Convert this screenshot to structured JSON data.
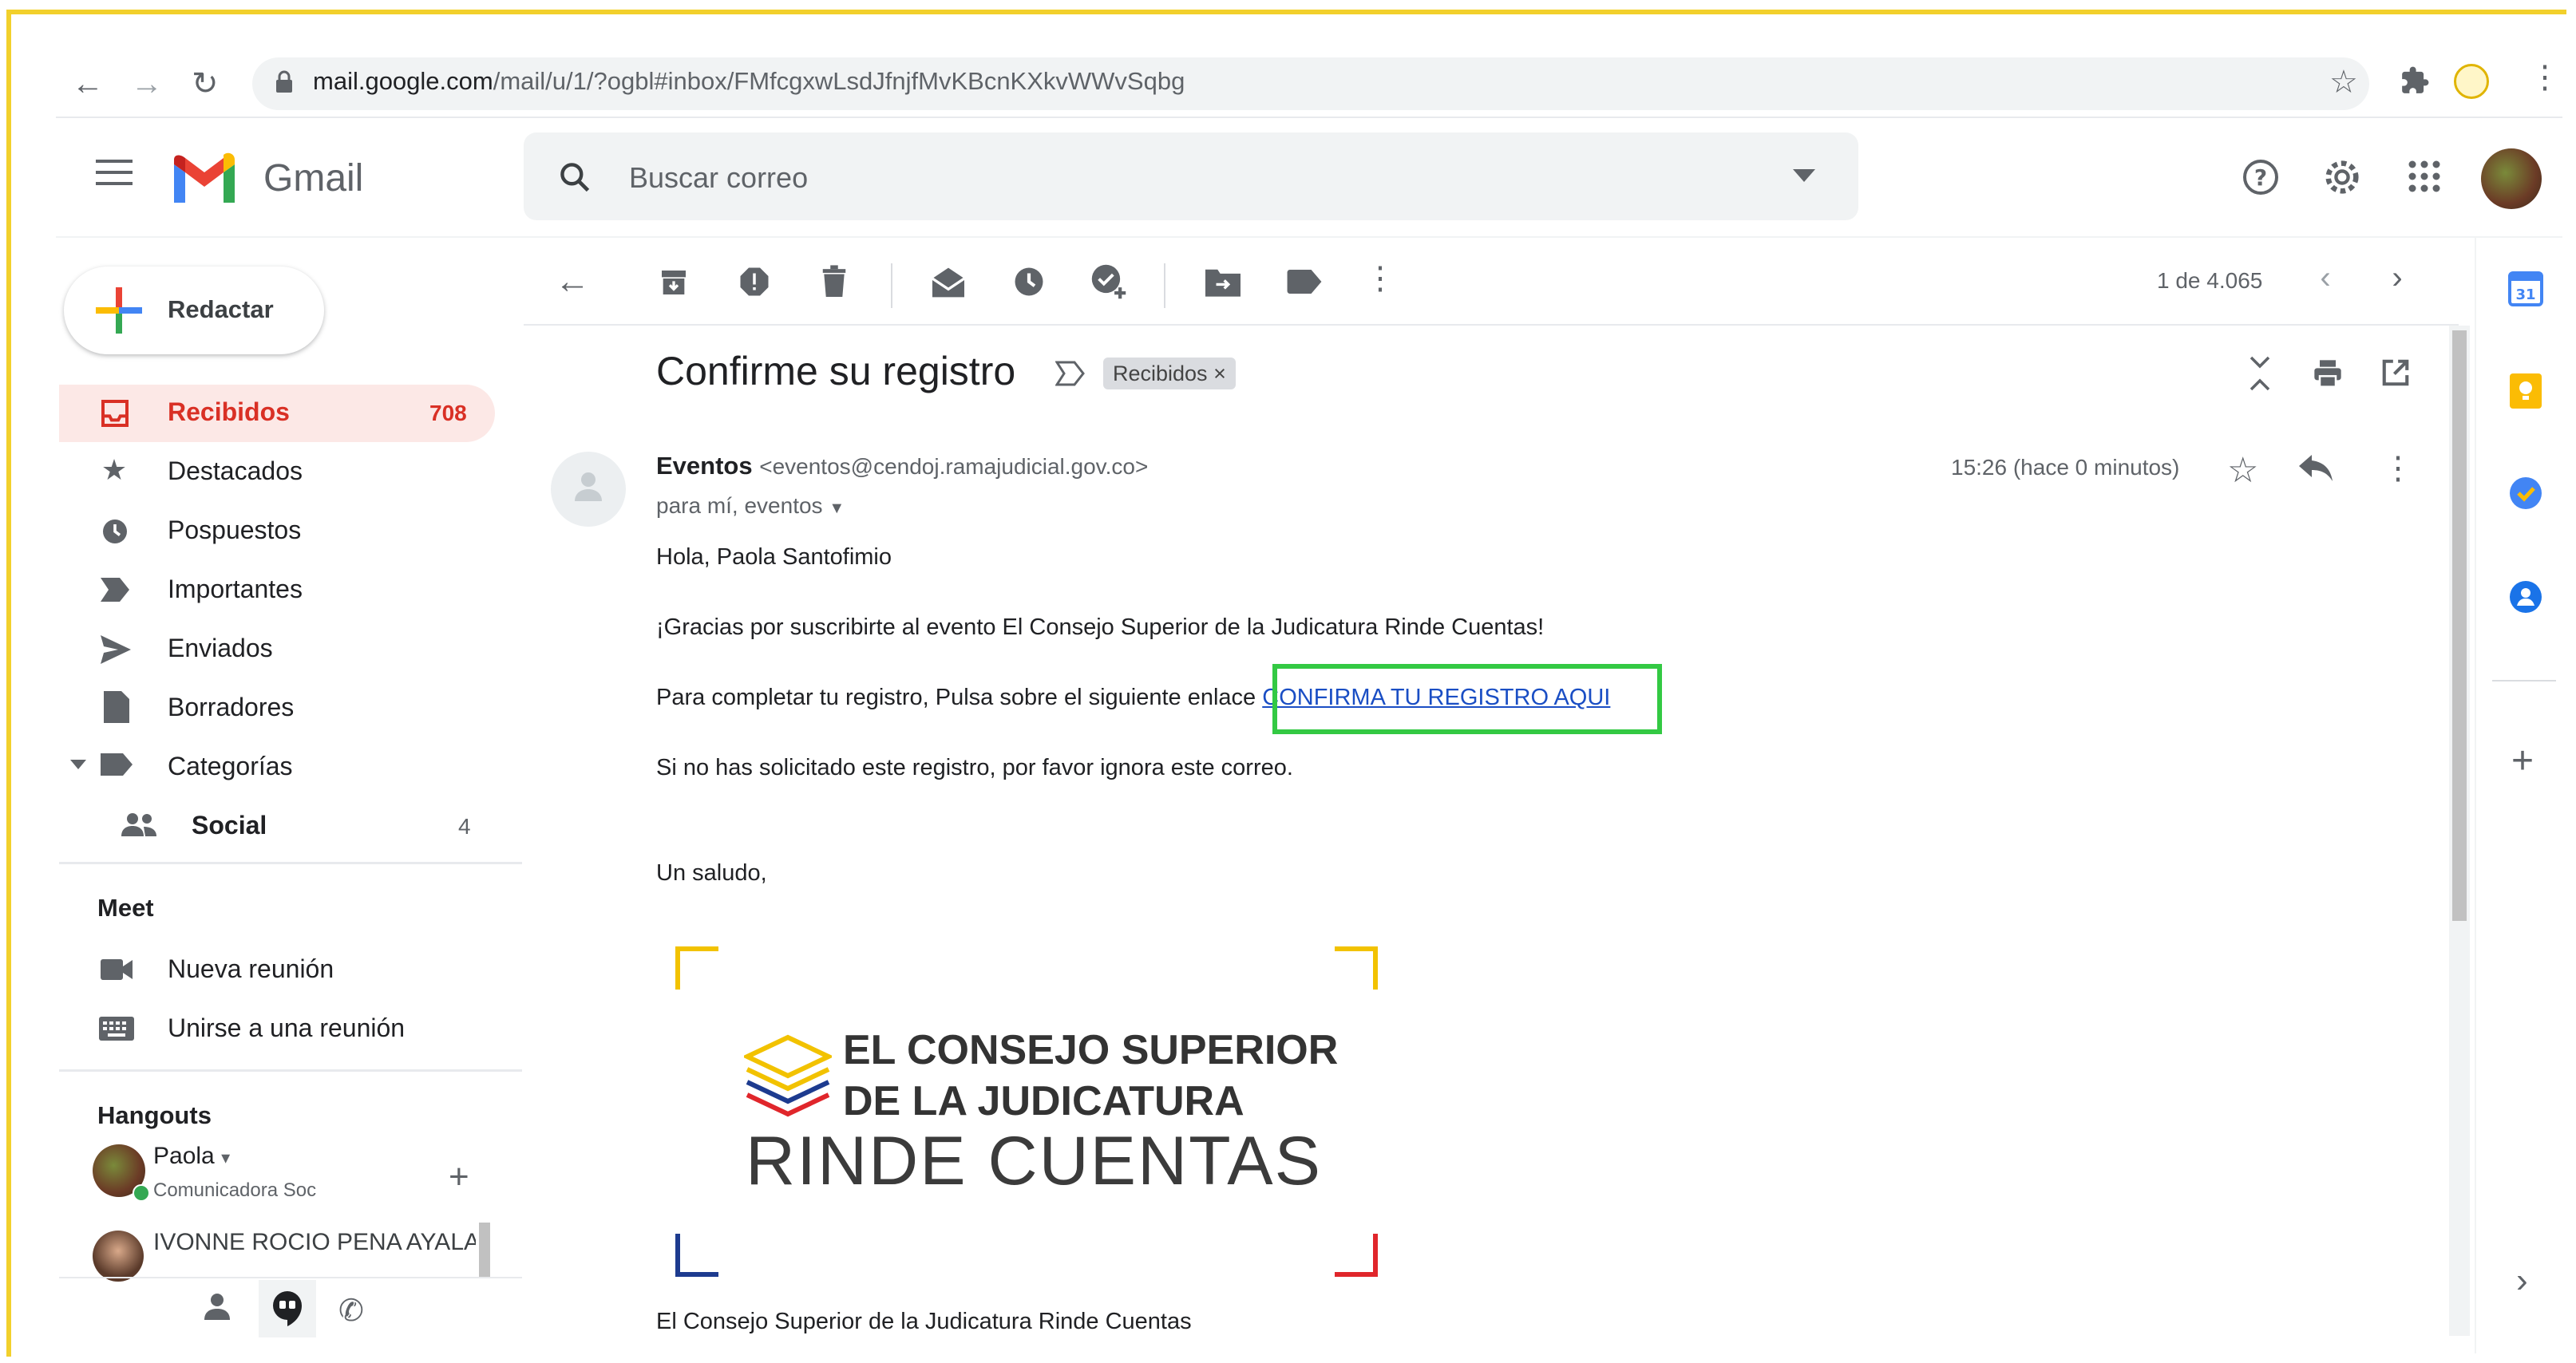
{
  "browser": {
    "url_host": "mail.google.com",
    "url_path": "/mail/u/1/?ogbl#inbox/FMfcgxwLsdJfnjfMvKBcnKXkvWWvSqbg"
  },
  "app": {
    "name": "Gmail",
    "search_placeholder": "Buscar correo"
  },
  "sidebar": {
    "compose_label": "Redactar",
    "items": [
      {
        "label": "Recibidos",
        "count": "708",
        "icon": "inbox-icon"
      },
      {
        "label": "Destacados",
        "icon": "star-icon"
      },
      {
        "label": "Pospuestos",
        "icon": "clock-icon"
      },
      {
        "label": "Importantes",
        "icon": "important-icon"
      },
      {
        "label": "Enviados",
        "icon": "send-icon"
      },
      {
        "label": "Borradores",
        "icon": "draft-icon"
      },
      {
        "label": "Categorías",
        "icon": "label-icon"
      },
      {
        "label": "Social",
        "count": "4",
        "icon": "people-icon"
      }
    ],
    "meet": {
      "title": "Meet",
      "items": [
        "Nueva reunión",
        "Unirse a una reunión"
      ]
    },
    "hangouts": {
      "title": "Hangouts",
      "contacts": [
        {
          "name": "Paola",
          "status": "Comunicadora Soc"
        },
        {
          "name": "IVONNE ROCIO PENA AYALA"
        }
      ]
    }
  },
  "toolbar": {
    "pagination": "1 de 4.065"
  },
  "email": {
    "subject": "Confirme su registro",
    "label_chip": "Recibidos",
    "sender_name": "Eventos",
    "sender_address": "<eventos@cendoj.ramajudicial.gov.co>",
    "to_line": "para mí, eventos",
    "time": "15:26 (hace 0 minutos)",
    "body": {
      "greeting": "Hola, Paola Santofimio",
      "thanks": "¡Gracias por suscribirte al evento El Consejo Superior de la Judicatura Rinde Cuentas!",
      "instruction": "Para completar tu registro, Pulsa sobre el siguiente enlace",
      "link_text": "CONFIRMA TU REGISTRO AQUI",
      "ignore": "Si no has solicitado este registro, por favor ignora este correo.",
      "signoff": "Un saludo,",
      "footer": "El Consejo Superior de la Judicatura Rinde Cuentas"
    },
    "logo": {
      "line1": "EL CONSEJO SUPERIOR",
      "line2": "DE LA JUDICATURA",
      "line3": "RINDE CUENTAS"
    }
  },
  "colors": {
    "gmail_red": "#d93025",
    "highlight_green": "#33c943",
    "link_blue": "#1a4ec4",
    "frame_yellow": "#f2d02c"
  }
}
